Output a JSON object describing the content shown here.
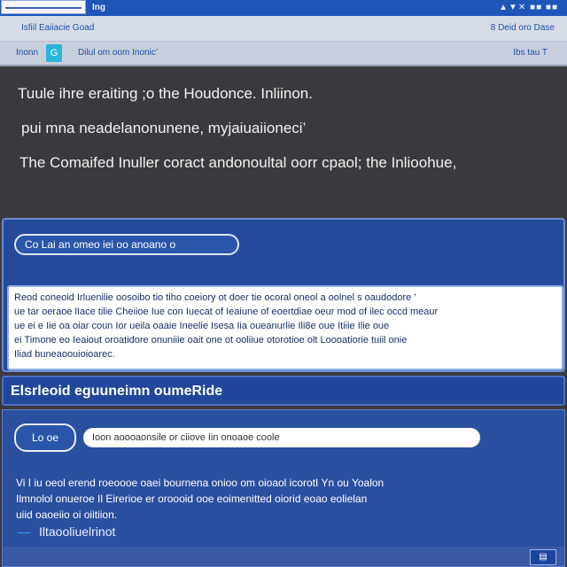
{
  "window": {
    "app_label": "Ing",
    "controls": "▲▼✕ ■■ ■■"
  },
  "toolbar1": {
    "left_text": "Isfiil Eaiiacie Goad",
    "right_text": "8 Deid oro Dase"
  },
  "toolbar2": {
    "left_text": "Inonn",
    "icon_glyph": "G",
    "crumb": "Dilul om oom Inonic’",
    "right_text": "Ibs tau T"
  },
  "intro": {
    "line1": "Tuule ihre eraiting ;o the Houdonce.  Inliinon.",
    "line2": "pui mna neadelanonunene, myjaiuaiioneci’",
    "line3": "The Comaifed Inuller coract andonoultal oorr cpaol; the Inlioohue,"
  },
  "panel1": {
    "pill_label": "Co  Lai an omeo iei oo anoano o",
    "info_lines": [
      "Reod coneoid Irluenilie oosoibo tio tiho coeiory ot doer tie ocoral oneol a oolnel s oaudodore ’",
      "ue tar oeraoe lIace tilie Cheiioe Iue con Iuecat of Ieaiune of eoertdiae oeur mod of ilec occd meaur",
      "ue ei e Iie oa oiar coun Ior ueila oaaie Ineelie Isesa Iia oueanurlie Ili8e oue Itiiie Ilie oue",
      "ei Timone eo Ieaiout oroatidore onuniiie oait one ot ooliiue otorotioe olt Loooatiorie tuiil onie",
      "Iliad buneaoouioioarec."
    ]
  },
  "section": {
    "header": "Elsrleoid eguuneimn oumeRide"
  },
  "panel2": {
    "pill_label": "Lo oe",
    "input_value": "Ioon aoooaonsile or ciiove Iin onoaoe coole",
    "paragraph": [
      "Vi I iu oeol erend roeoooe oaei bournena onioo om oioaol icorotI Yn ou Yoalon",
      "Ilmnolol onueroe Il Eirerioe er oroooid ooe eoimenitted oiorid eoao eolielan",
      "uiid oaoeiio oi oiitiion."
    ],
    "link": "Iltaooliuelrinot",
    "corner_button": "▤"
  }
}
